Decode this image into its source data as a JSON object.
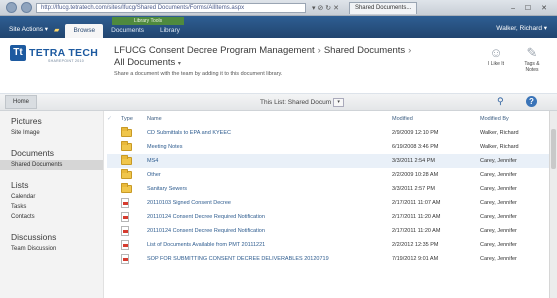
{
  "browser": {
    "url": "http://lfucg.tetratech.com/sites/lfucg/Shared Documents/Forms/AllItems.aspx",
    "url_controls": "▾ ⊘ ↻ ✕",
    "tab_label": "Shared Documents...",
    "window_controls": "– ☐ ✕"
  },
  "ribbon": {
    "site_actions": "Site Actions ▾",
    "context_group": "Library Tools",
    "tabs": [
      "Browse",
      "Documents",
      "Library"
    ],
    "user": "Walker, Richard ▾"
  },
  "header": {
    "logo_text": "TETRA TECH",
    "logo_mark": "Tt",
    "logo_sub": "SHAREPOINT 2010",
    "breadcrumb": [
      "LFUCG Consent Decree Program Management",
      "Shared Documents"
    ],
    "breadcrumb_sep": "›",
    "breadcrumb_tail": "›",
    "view": "All Documents",
    "view_chevron": "▾",
    "description": "Share a document with the team by adding it to this document library.",
    "social": [
      {
        "icon": "☺",
        "label": "I Like It"
      },
      {
        "icon": "✎",
        "label": "Tags & Notes"
      }
    ]
  },
  "navbar": {
    "home": "Home",
    "search_scope": "This List: Shared Docum",
    "search_scope_arrow": "▾",
    "search_icon": "⚲",
    "help_icon": "?"
  },
  "quicklaunch": {
    "sections": [
      {
        "heading": "Pictures",
        "items": [
          "Site Image"
        ]
      },
      {
        "heading": "Documents",
        "items": [
          "Shared Documents"
        ]
      },
      {
        "heading": "Lists",
        "items": [
          "Calendar",
          "Tasks",
          "Contacts"
        ]
      },
      {
        "heading": "Discussions",
        "items": [
          "Team Discussion"
        ]
      }
    ]
  },
  "table": {
    "headers": {
      "type": "Type",
      "name": "Name",
      "modified": "Modified",
      "modified_by": "Modified By"
    },
    "check_glyph": "✓",
    "rows": [
      {
        "icon": "folder",
        "name": "CD Submittals to EPA and KYEEC",
        "modified": "2/9/2009 12:10 PM",
        "modified_by": "Walker, Richard"
      },
      {
        "icon": "folder",
        "name": "Meeting Notes",
        "modified": "6/19/2008 3:46 PM",
        "modified_by": "Walker, Richard"
      },
      {
        "icon": "folder",
        "name": "MS4",
        "modified": "3/3/2011 2:54 PM",
        "modified_by": "Carey, Jennifer"
      },
      {
        "icon": "folder",
        "name": "Other",
        "modified": "2/2/2009 10:28 AM",
        "modified_by": "Carey, Jennifer"
      },
      {
        "icon": "folder",
        "name": "Sanitary Sewers",
        "modified": "3/3/2011 2:57 PM",
        "modified_by": "Carey, Jennifer"
      },
      {
        "icon": "pdf",
        "name": "20110103 Signed Consent Decree",
        "modified": "2/17/2011 11:07 AM",
        "modified_by": "Carey, Jennifer"
      },
      {
        "icon": "pdf",
        "name": "20110124 Consent Decree Required Notification",
        "modified": "2/17/2011 11:20 AM",
        "modified_by": "Carey, Jennifer"
      },
      {
        "icon": "pdf",
        "name": "20110124 Consent Decree Required Notification",
        "modified": "2/17/2011 11:20 AM",
        "modified_by": "Carey, Jennifer"
      },
      {
        "icon": "pdf",
        "name": "List of Documents Available from PMT 20111221",
        "modified": "2/2/2012 12:35 PM",
        "modified_by": "Carey, Jennifer"
      },
      {
        "icon": "pdf",
        "name": "SOP FOR SUBMITTING CONSENT DECREE DELIVERABLES 20120719",
        "modified": "7/19/2012 9:01 AM",
        "modified_by": "Carey, Jennifer"
      }
    ]
  }
}
